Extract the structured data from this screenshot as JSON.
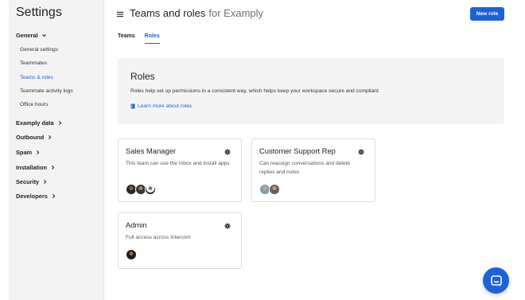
{
  "sidebar": {
    "title": "Settings",
    "groups": [
      {
        "label": "General",
        "expanded": true
      },
      {
        "label": "Examply data"
      },
      {
        "label": "Outbound"
      },
      {
        "label": "Spam"
      },
      {
        "label": "Installation"
      },
      {
        "label": "Security"
      },
      {
        "label": "Developers"
      }
    ],
    "general_items": [
      {
        "label": "General settings"
      },
      {
        "label": "Teammates"
      },
      {
        "label": "Teams & roles",
        "active": true
      },
      {
        "label": "Teammate activity logs"
      },
      {
        "label": "Office hours"
      }
    ]
  },
  "header": {
    "title": "Teams and roles",
    "title_suffix": "for Examply",
    "new_role_label": "New role"
  },
  "tabs": [
    {
      "label": "Teams"
    },
    {
      "label": "Roles",
      "active": true
    }
  ],
  "banner": {
    "title": "Roles",
    "text": "Roles help set up permissions in a consistent way, which helps keep your workspace secure and compliant.",
    "link": "Learn more about roles"
  },
  "roles": [
    {
      "title": "Sales Manager",
      "description": "This team can use the Inbox and install apps",
      "avatar_count": 3
    },
    {
      "title": "Customer Support Rep",
      "description": "Can reassign conversations and delete replies and notes",
      "avatar_count": 2
    },
    {
      "title": "Admin",
      "description": "Full access across Intercom",
      "avatar_count": 1
    }
  ],
  "colors": {
    "accent": "#1f61d9",
    "sidebar_bg": "#f3f3f3",
    "banner_bg": "#f4f4f4"
  },
  "icons": {
    "menu": "hamburger-icon",
    "gear": "gear-icon",
    "book": "book-icon",
    "chat": "chat-icon",
    "chevron": "chevron-icon"
  }
}
